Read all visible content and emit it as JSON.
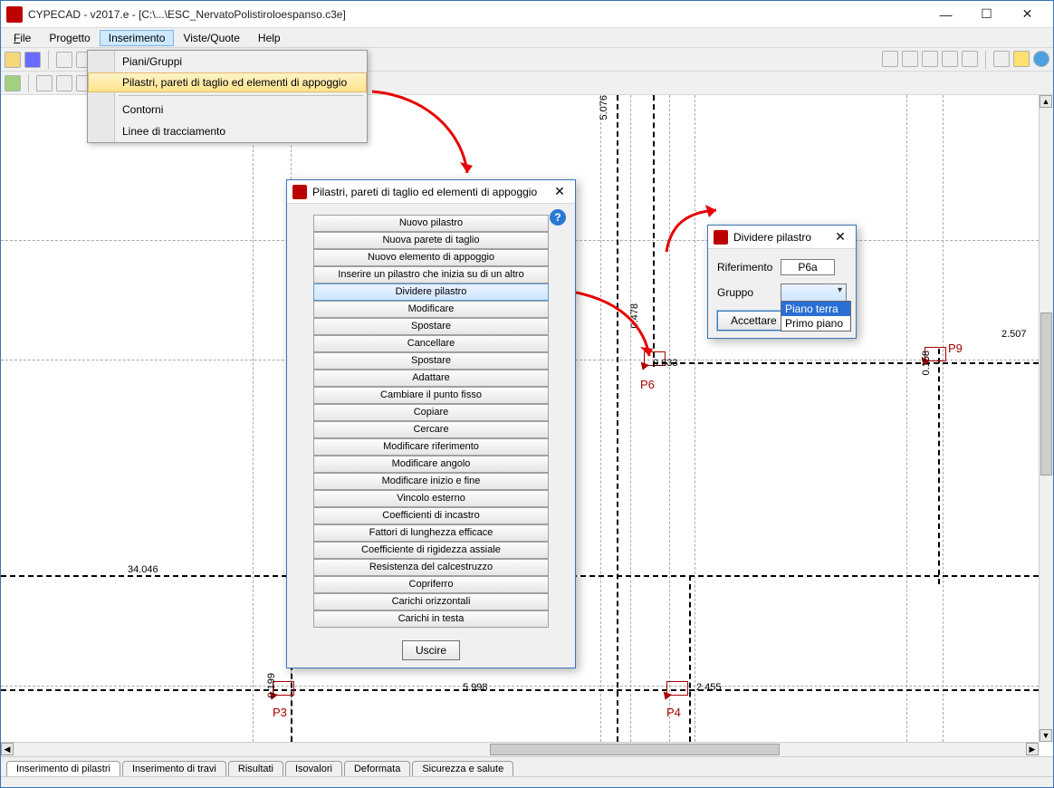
{
  "window": {
    "title": "CYPECAD - v2017.e - [C:\\...\\ESC_NervatoPolistiroloespanso.c3e]"
  },
  "menubar": {
    "file": "File",
    "progetto": "Progetto",
    "inserimento": "Inserimento",
    "viste": "Viste/Quote",
    "help": "Help"
  },
  "dropdown": {
    "item1": "Piani/Gruppi",
    "item2": "Pilastri, pareti di taglio ed elementi di appoggio",
    "item3": "Contorni",
    "item4": "Linee di tracciamento"
  },
  "dialog1": {
    "title": "Pilastri, pareti di taglio ed elementi di appoggio",
    "buttons": {
      "b1": "Nuovo pilastro",
      "b2": "Nuova parete di taglio",
      "b3": "Nuovo elemento di appoggio",
      "b4": "Inserire un pilastro che inizia su di un altro",
      "b5": "Dividere pilastro",
      "b6": "Modificare",
      "b7": "Spostare",
      "b8": "Cancellare",
      "b9": "Spostare",
      "b10": "Adattare",
      "b11": "Cambiare il punto fisso",
      "b12": "Copiare",
      "b13": "Cercare",
      "b14": "Modificare riferimento",
      "b15": "Modificare angolo",
      "b16": "Modificare inizio e fine",
      "b17": "Vincolo esterno",
      "b18": "Coefficienti di incastro",
      "b19": "Fattori di lunghezza efficace",
      "b20": "Coefficiente di rigidezza assiale",
      "b21": "Resistenza del calcestruzzo",
      "b22": "Copriferro",
      "b23": "Carichi orizzontali",
      "b24": "Carichi in testa"
    },
    "exit": "Uscire"
  },
  "dialog2": {
    "title": "Dividere pilastro",
    "riferimento_label": "Riferimento",
    "riferimento_value": "P6a",
    "gruppo_label": "Gruppo",
    "accept": "Accettare",
    "options": {
      "o1": "Piano terra",
      "o2": "Primo piano"
    }
  },
  "drawing": {
    "p3": "P3",
    "p4": "P4",
    "p6": "P6",
    "p9": "P9",
    "d34": "34.046",
    "d5998": "5.998",
    "d2455": "2.455",
    "d5076": "5.076",
    "d0478": "0.478",
    "d0633": "0.633",
    "d0158": "0.158",
    "d2507": "2.507",
    "d0199": "0.199"
  },
  "tabs": {
    "t1": "Inserimento di pilastri",
    "t2": "Inserimento di travi",
    "t3": "Risultati",
    "t4": "Isovalori",
    "t5": "Deformata",
    "t6": "Sicurezza e salute"
  }
}
